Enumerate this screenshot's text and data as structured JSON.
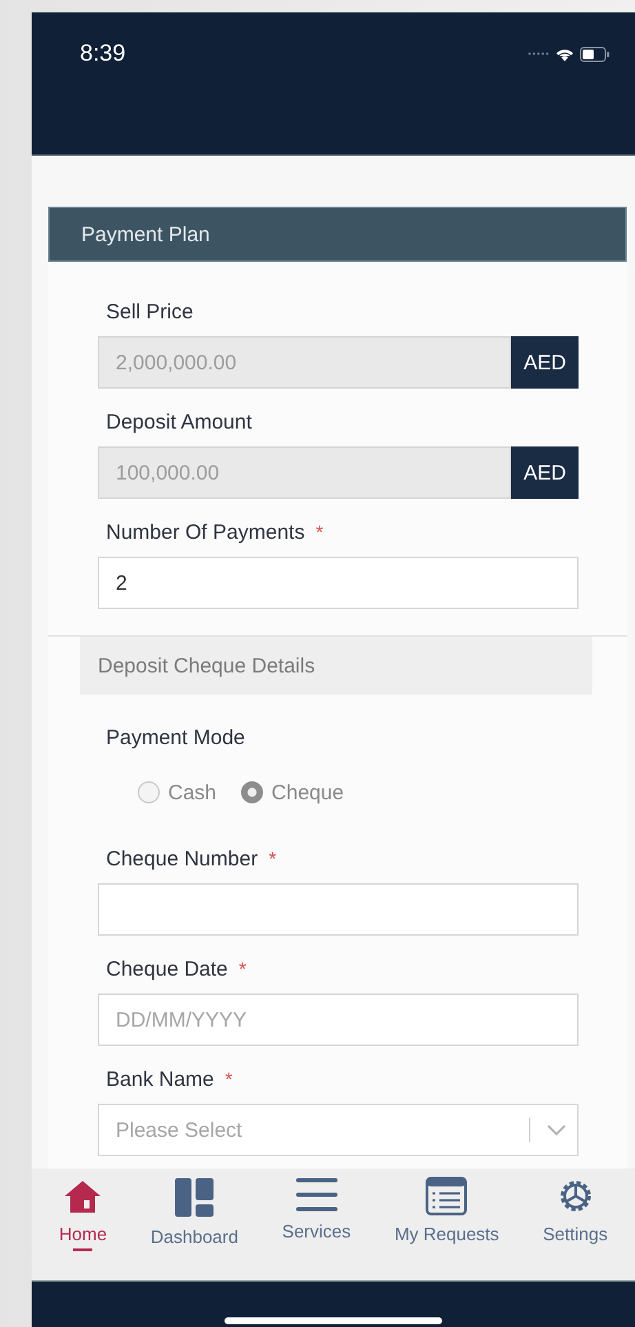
{
  "status_bar": {
    "time": "8:39"
  },
  "section": {
    "title": "Payment Plan"
  },
  "fields": [
    {
      "kind": "currency",
      "label": "Sell Price",
      "value": "2,000,000.00",
      "currency": "AED",
      "disabled": true
    },
    {
      "kind": "currency",
      "label": "Deposit Amount",
      "value": "100,000.00",
      "currency": "AED",
      "disabled": true
    },
    {
      "kind": "text",
      "label": "Number Of Payments",
      "required_mark": "*",
      "value": "2"
    },
    {
      "kind": "subsection",
      "label": "Deposit Cheque Details"
    },
    {
      "kind": "radio",
      "label": "Payment Mode",
      "options": [
        {
          "label": "Cash",
          "selected": false
        },
        {
          "label": "Cheque",
          "selected": true
        }
      ]
    },
    {
      "kind": "text",
      "label": "Cheque Number",
      "required_mark": "*"
    },
    {
      "kind": "text",
      "label": "Cheque Date",
      "required_mark": "*",
      "placeholder": "DD/MM/YYYY"
    },
    {
      "kind": "select",
      "label": "Bank Name",
      "required_mark": "*",
      "placeholder": "Please Select"
    }
  ],
  "nav": [
    {
      "label": "Home",
      "selected": true
    },
    {
      "label": "Dashboard",
      "selected": false
    },
    {
      "label": "Services",
      "selected": false
    },
    {
      "label": "My Requests",
      "selected": false
    },
    {
      "label": "Settings",
      "selected": false
    }
  ]
}
